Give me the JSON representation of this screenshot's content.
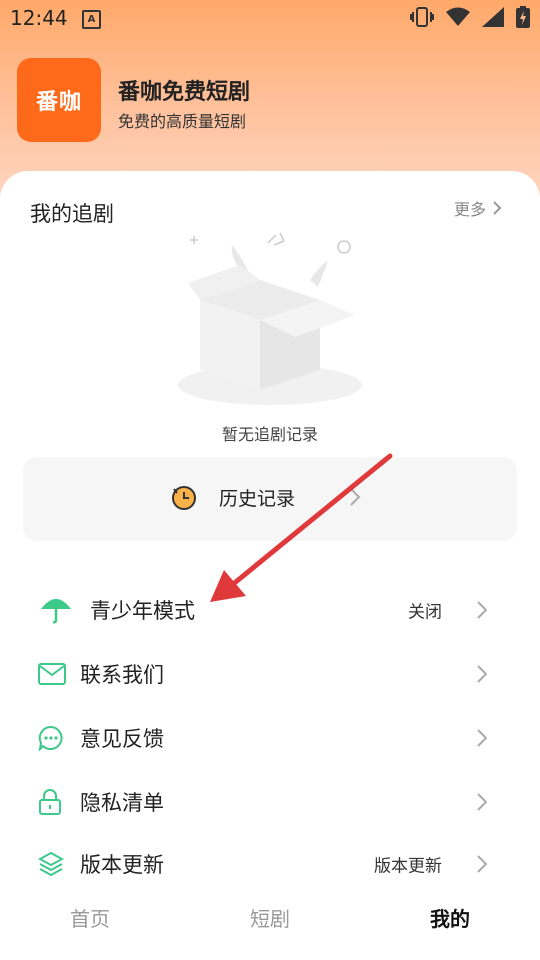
{
  "status_bar": {
    "time": "12:44",
    "notification_icon_letter": "A"
  },
  "header": {
    "logo_text": "番咖",
    "app_name": "番咖免费短剧",
    "slogan": "免费的高质量短剧"
  },
  "following": {
    "title": "我的追剧",
    "more_label": "更多",
    "empty_text": "暂无追剧记录"
  },
  "history": {
    "label": "历史记录"
  },
  "menu": {
    "items": [
      {
        "label": "青少年模式",
        "value": "关闭",
        "icon": "umbrella-icon"
      },
      {
        "label": "联系我们",
        "value": "",
        "icon": "mail-icon"
      },
      {
        "label": "意见反馈",
        "value": "",
        "icon": "chat-bubble-icon"
      },
      {
        "label": "隐私清单",
        "value": "",
        "icon": "lock-icon"
      },
      {
        "label": "版本更新",
        "value": "版本更新",
        "icon": "layers-icon"
      }
    ]
  },
  "bottom_nav": {
    "tabs": [
      {
        "label": "首页"
      },
      {
        "label": "短剧"
      },
      {
        "label": "我的"
      }
    ],
    "active_index": 2
  },
  "colors": {
    "brand": "#ff6a1a",
    "accent_green": "#3cc98a",
    "annotation_red": "#e0393b"
  }
}
